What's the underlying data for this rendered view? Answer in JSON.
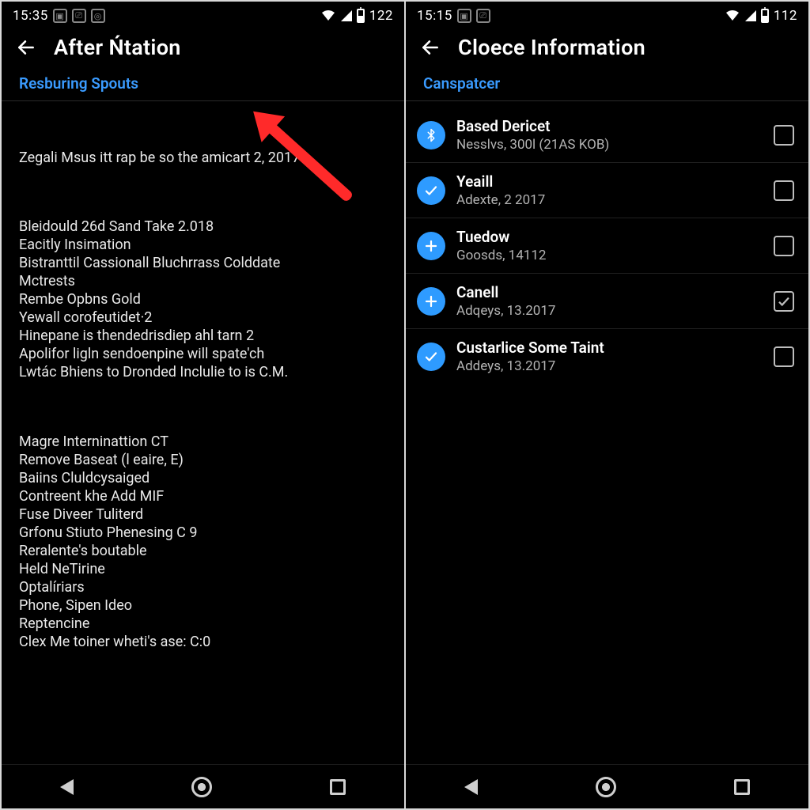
{
  "left": {
    "status": {
      "time": "15:35",
      "battery_pct": "122"
    },
    "header": {
      "title": "After Ńtation"
    },
    "section_heading": "Resburing Spouts",
    "blocks": [
      "Zegali Msus itt rap be so the amicart 2, 2017",
      "Bleidould 26d Sand Take 2.018\nEacitly Insimation\nBistranttil Cassionall Bluchrrass Colddate\nMctrests\nRembe Opbns Gold\nYewall corofeutidet·2\nHinepane is thendedrisdiep ahl tarn 2\nApolifor ligln sendoenpine will spate'ch\nLwtác Bhiens to Dronded Inclulie to is C.M.",
      "Magre Interninattion CT\nRemove Baseat (l eaire, E)\nBaiins Cluldcysaiged\nContreent khe Add MIF\nFuse Diveer Tuliterd\nGrfonu Stiuto Phenesing C 9\nReralente's boutable\nHeld NeTirine\nOptalíriars\nPhone, Sipen Ideo\nReptencine\nClex Me toiner wheti's ase: C:0"
    ]
  },
  "right": {
    "status": {
      "time": "15:15",
      "battery_pct": "112"
    },
    "header": {
      "title": "Cloece Information"
    },
    "section_heading": "Canspatcer",
    "items": [
      {
        "icon": "bluetooth",
        "title": "Based Dericet",
        "sub": "Nesslvs, 300l (21AS KOB)",
        "checked": false
      },
      {
        "icon": "check",
        "title": "Yeaill",
        "sub": "Adexte, 2 2017",
        "checked": false
      },
      {
        "icon": "plus",
        "title": "Tuedow",
        "sub": "Goosds, 14112",
        "checked": false
      },
      {
        "icon": "plus",
        "title": "Canell",
        "sub": "Adqeys, 13.2017",
        "checked": true
      },
      {
        "icon": "check",
        "title": "Custarlice Some Taint",
        "sub": "Addeys, 13.2017",
        "checked": false
      }
    ]
  },
  "overlay": {
    "arrow_color": "#ff2a2a"
  }
}
